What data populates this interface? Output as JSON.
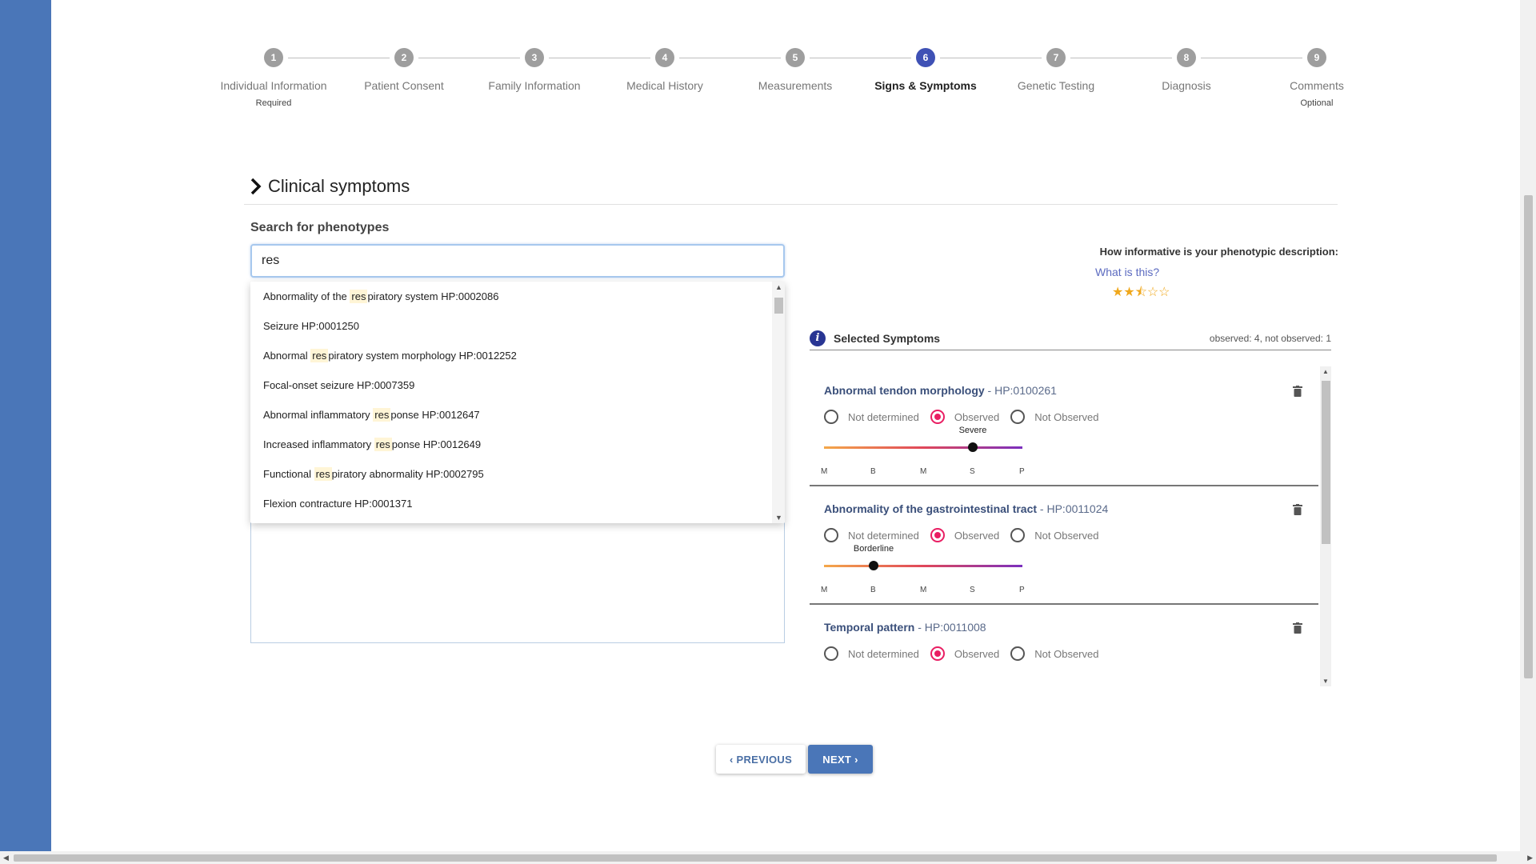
{
  "stepper": {
    "steps": [
      {
        "num": "1",
        "label": "Individual Information",
        "sub": "Required"
      },
      {
        "num": "2",
        "label": "Patient Consent",
        "sub": ""
      },
      {
        "num": "3",
        "label": "Family Information",
        "sub": ""
      },
      {
        "num": "4",
        "label": "Medical History",
        "sub": ""
      },
      {
        "num": "5",
        "label": "Measurements",
        "sub": ""
      },
      {
        "num": "6",
        "label": "Signs & Symptoms",
        "sub": ""
      },
      {
        "num": "7",
        "label": "Genetic Testing",
        "sub": ""
      },
      {
        "num": "8",
        "label": "Diagnosis",
        "sub": ""
      },
      {
        "num": "9",
        "label": "Comments",
        "sub": "Optional"
      }
    ],
    "active_step": 6
  },
  "section": {
    "title": "Clinical symptoms",
    "search_label": "Search for phenotypes",
    "search_value": "res"
  },
  "dropdown": {
    "items": [
      {
        "pre": "Abnormality of the ",
        "hl": "res",
        "post": "piratory system HP:0002086"
      },
      {
        "pre": "Seizure HP:0001250",
        "hl": "",
        "post": ""
      },
      {
        "pre": "Abnormal ",
        "hl": "res",
        "post": "piratory system morphology HP:0012252"
      },
      {
        "pre": "Focal-onset seizure HP:0007359",
        "hl": "",
        "post": ""
      },
      {
        "pre": "Abnormal inflammatory ",
        "hl": "res",
        "post": "ponse HP:0012647"
      },
      {
        "pre": "Increased inflammatory ",
        "hl": "res",
        "post": "ponse HP:0012649"
      },
      {
        "pre": "Functional ",
        "hl": "res",
        "post": "piratory abnormality HP:0002795"
      },
      {
        "pre": "Flexion contracture HP:0001371",
        "hl": "",
        "post": ""
      }
    ]
  },
  "informativeness": {
    "question": "How informative is your phenotypic description:",
    "link": "What is this?",
    "stars": "★★⯪☆☆"
  },
  "selected": {
    "title": "Selected Symptoms",
    "counts": "observed: 4, not observed: 1",
    "info_icon_glyph": "i",
    "radio_labels": [
      "Not determined",
      "Observed",
      "Not Observed"
    ],
    "tick_labels": [
      "M",
      "B",
      "M",
      "S",
      "P"
    ],
    "symptoms": [
      {
        "name": "Abnormal tendon morphology",
        "code": " - HP:0100261",
        "observed": 1,
        "severity_label": "Severe",
        "severity_index": 3
      },
      {
        "name": "Abnormality of the gastrointestinal tract",
        "code": " - HP:0011024",
        "observed": 1,
        "severity_label": "Borderline",
        "severity_index": 1
      },
      {
        "name": "Temporal pattern",
        "code": " - HP:0011008",
        "observed": 1,
        "severity_label": "",
        "severity_index": null
      }
    ]
  },
  "buttons": {
    "previous": "‹ PREVIOUS",
    "next": "NEXT ›"
  },
  "colors": {
    "accent": "#3f51b5",
    "rail": "#4a76b8",
    "observed": "#e91e63",
    "star": "#f0a81c"
  }
}
